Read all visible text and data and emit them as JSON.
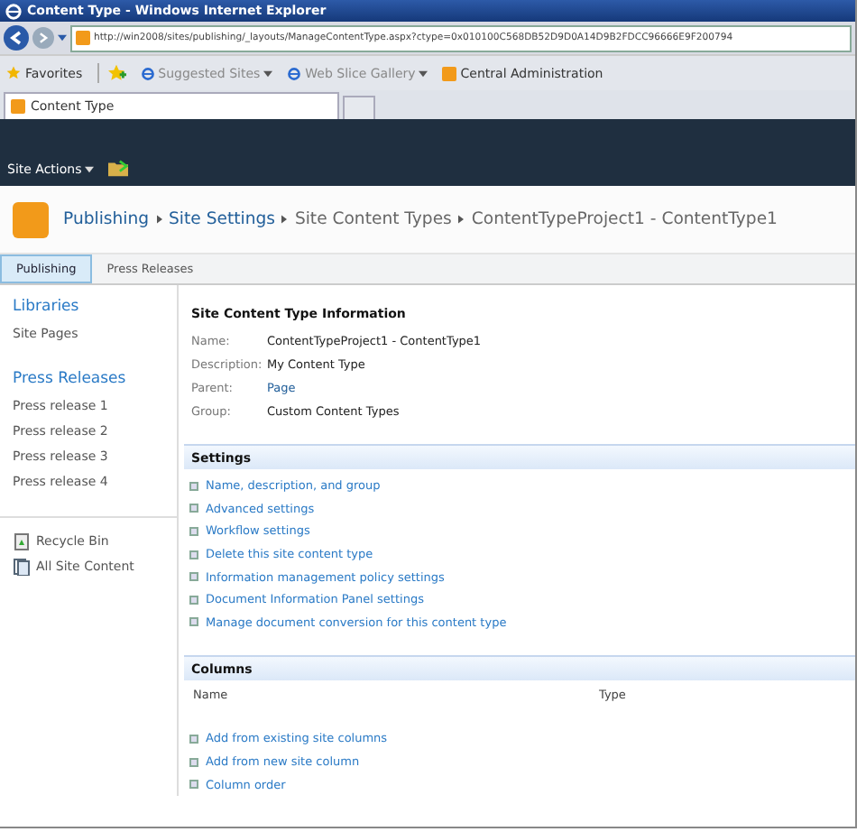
{
  "window": {
    "title": "Content Type - Windows Internet Explorer"
  },
  "address_bar": {
    "value": "http://win2008/sites/publishing/_layouts/ManageContentType.aspx?ctype=0x010100C568DB52D9D0A14D9B2FDCC96666E9F200794"
  },
  "favorites_bar": {
    "favorites": "Favorites",
    "items": [
      {
        "label": "Suggested Sites",
        "dropdown": true
      },
      {
        "label": "Web Slice Gallery",
        "dropdown": true
      },
      {
        "label": "Central Administration",
        "dropdown": false
      }
    ]
  },
  "browser_tabs": [
    {
      "label": "Content Type",
      "selected": true
    }
  ],
  "ribbon": {
    "site_actions": "Site Actions"
  },
  "breadcrumb": [
    {
      "label": "Publishing",
      "kind": "link"
    },
    {
      "label": "Site Settings",
      "kind": "link"
    },
    {
      "label": "Site Content Types",
      "kind": "muted"
    },
    {
      "label": "ContentTypeProject1 - ContentType1",
      "kind": "muted"
    }
  ],
  "top_nav": [
    {
      "label": "Publishing",
      "selected": true
    },
    {
      "label": "Press Releases",
      "selected": false
    }
  ],
  "sidebar": {
    "sections": [
      {
        "heading": "Libraries",
        "items": [
          "Site Pages"
        ]
      },
      {
        "heading": "Press Releases",
        "items": [
          "Press release 1",
          "Press release 2",
          "Press release 3",
          "Press release 4"
        ]
      }
    ],
    "footer": [
      {
        "label": "Recycle Bin",
        "kind": "recycle"
      },
      {
        "label": "All Site Content",
        "kind": "content"
      }
    ]
  },
  "info": {
    "title": "Site Content Type Information",
    "rows": [
      {
        "label": "Name:",
        "value": "ContentTypeProject1 - ContentType1",
        "link": false
      },
      {
        "label": "Description:",
        "value": "My Content Type",
        "link": false
      },
      {
        "label": "Parent:",
        "value": "Page",
        "link": true
      },
      {
        "label": "Group:",
        "value": "Custom Content Types",
        "link": false
      }
    ]
  },
  "settings": {
    "title": "Settings",
    "links": [
      "Name, description, and group",
      "Advanced settings",
      "Workflow settings",
      "Delete this site content type",
      "Information management policy settings",
      "Document Information Panel settings",
      "Manage document conversion for this content type"
    ]
  },
  "columns": {
    "title": "Columns",
    "headers": [
      "Name",
      "Type"
    ],
    "links": [
      "Add from existing site columns",
      "Add from new site column",
      "Column order"
    ]
  }
}
